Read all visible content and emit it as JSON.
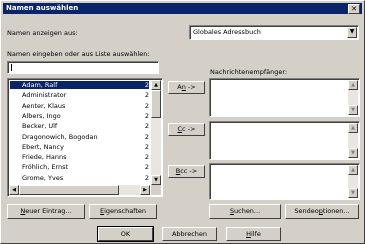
{
  "window": {
    "title": "Namen auswählen",
    "close_glyph": "✕"
  },
  "show_names": {
    "label": "Namen anzeigen aus:",
    "value": "Globales Adressbuch"
  },
  "search": {
    "label": "Namen eingeben oder aus Liste auswählen:",
    "value": ""
  },
  "names": [
    {
      "name": "Adam, Ralf",
      "num": "2"
    },
    {
      "name": "Administrator",
      "num": "2"
    },
    {
      "name": "Aenter, Klaus",
      "num": "2"
    },
    {
      "name": "Albers, Ingo",
      "num": "2"
    },
    {
      "name": "Becker, Ulf",
      "num": "2"
    },
    {
      "name": "Dragonowich, Bogodan",
      "num": "2"
    },
    {
      "name": "Ebert, Nancy",
      "num": "2"
    },
    {
      "name": "Friede, Hanns",
      "num": "2"
    },
    {
      "name": "Fröhlich, Ernst",
      "num": "2"
    },
    {
      "name": "Grome, Yves",
      "num": "2"
    }
  ],
  "recipients": {
    "label": "Nachrichtenempfänger:"
  },
  "recipient_buttons": {
    "an_prefix": "A",
    "an_ul": "n",
    "an_suffix": " ->",
    "cc_prefix": "",
    "cc_ul": "C",
    "cc_suffix": "c ->",
    "bcc_prefix": "",
    "bcc_ul": "B",
    "bcc_suffix": "cc ->"
  },
  "buttons": {
    "new_entry_ul": "N",
    "new_entry_rest": "euer Eintrag...",
    "properties_ul": "E",
    "properties_rest": "igenschaften",
    "search_ul": "S",
    "search_rest": "uchen...",
    "send_options_pre": "Sendeo",
    "send_options_ul": "p",
    "send_options_post": "tionen...",
    "ok": "OK",
    "cancel": "Abbrechen",
    "help_ul": "H",
    "help_rest": "ilfe"
  }
}
